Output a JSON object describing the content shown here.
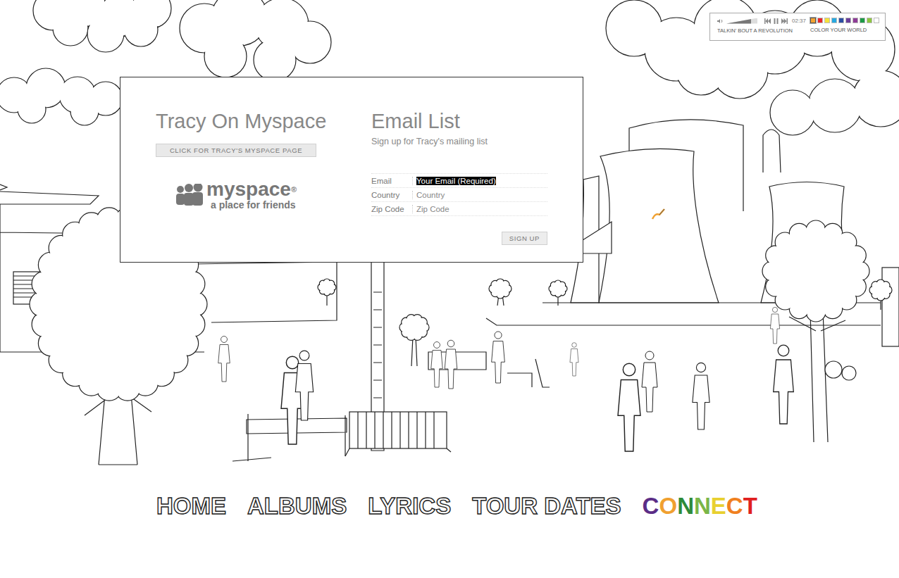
{
  "player": {
    "track": "TALKIN' BOUT A REVOLUTION",
    "time": "02:37",
    "volume_level": 0.8,
    "playing": true,
    "swatch_label": "COLOR YOUR WORLD",
    "swatches": [
      {
        "color": "#f4a330",
        "selected": true
      },
      {
        "color": "#e8262a",
        "selected": false
      },
      {
        "color": "#f5e23b",
        "selected": false
      },
      {
        "color": "#27a9e1",
        "selected": false
      },
      {
        "color": "#2b4ea2",
        "selected": false
      },
      {
        "color": "#6a3d9a",
        "selected": false
      },
      {
        "color": "#8e3c97",
        "selected": false
      },
      {
        "color": "#1c9a47",
        "selected": false
      },
      {
        "color": "#8dc63f",
        "selected": false
      },
      {
        "color": "#ffffff",
        "selected": false
      }
    ]
  },
  "myspace": {
    "title": "Tracy On Myspace",
    "button": "CLICK FOR TRACY'S MYSPACE PAGE",
    "logo_text": "myspace",
    "logo_mark": "®",
    "tagline": "a place for friends"
  },
  "email_list": {
    "title": "Email List",
    "subtitle": "Sign up for Tracy's mailing list",
    "fields": [
      {
        "label": "Email",
        "value": "Your Email (Required)",
        "selected": true
      },
      {
        "label": "Country",
        "value": "Country",
        "selected": false
      },
      {
        "label": "Zip Code",
        "value": "Zip Code",
        "selected": false
      }
    ],
    "submit": "SIGN UP"
  },
  "nav": [
    {
      "label": "HOME",
      "selected": false,
      "letter_colors": []
    },
    {
      "label": "ALBUMS",
      "selected": false,
      "letter_colors": []
    },
    {
      "label": "LYRICS",
      "selected": false,
      "letter_colors": []
    },
    {
      "label": "TOUR DATES",
      "selected": false,
      "letter_colors": []
    },
    {
      "label": "CONNECT",
      "selected": true,
      "letter_colors": [
        "#5b2d86",
        "#f0a030",
        "#2e8b3a",
        "#7ab648",
        "#e8d030",
        "#f08020",
        "#e02020"
      ]
    }
  ]
}
